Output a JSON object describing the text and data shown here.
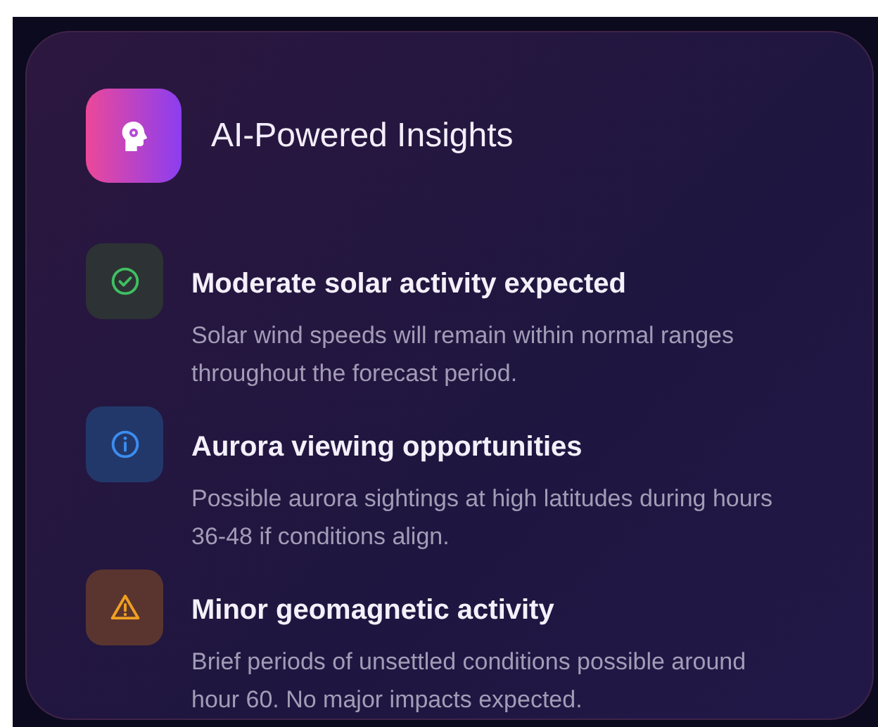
{
  "card": {
    "title": "AI-Powered Insights"
  },
  "insights": [
    {
      "kind": "success",
      "title": "Moderate solar activity expected",
      "description": "Solar wind speeds will remain within normal ranges throughout the forecast period."
    },
    {
      "kind": "info",
      "title": "Aurora viewing opportunities",
      "description": "Possible aurora sightings at high latitudes during hours 36-48 if conditions align."
    },
    {
      "kind": "warning",
      "title": "Minor geomagnetic activity",
      "description": "Brief periods of unsettled conditions possible around hour 60. No major impacts expected."
    }
  ]
}
